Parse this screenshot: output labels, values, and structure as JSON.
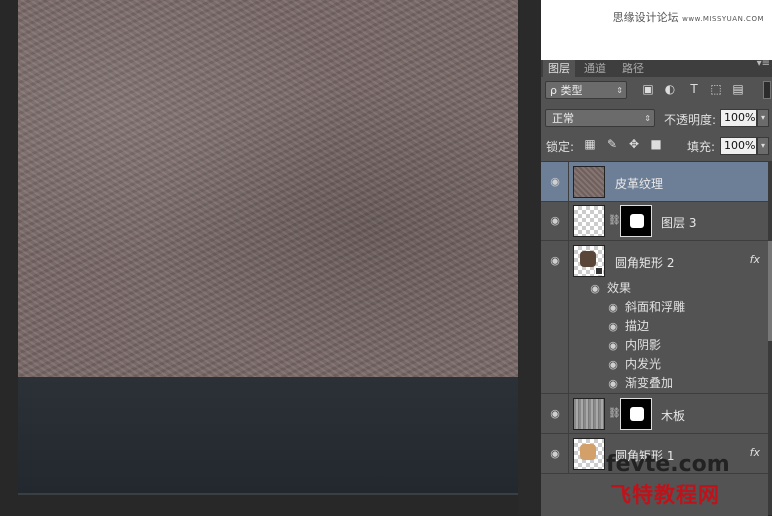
{
  "banner": {
    "site_cn": "思缘设计论坛",
    "site_url": "www.MISSYUAN.COM"
  },
  "tabs": [
    {
      "label": "图层",
      "active": true
    },
    {
      "label": "通道",
      "active": false
    },
    {
      "label": "路径",
      "active": false
    }
  ],
  "panel_menu_icon": "panel-menu-icon",
  "filter": {
    "kind_prefix": "ρ",
    "kind_label": "类型",
    "icons": [
      "image-filter-icon",
      "adjustment-filter-icon",
      "type-filter-icon",
      "shape-filter-icon",
      "smart-object-filter-icon"
    ]
  },
  "blend": {
    "mode": "正常",
    "opacity_label": "不透明度:",
    "opacity": "100%",
    "lock_label": "锁定:",
    "fill_label": "填充:",
    "fill": "100%"
  },
  "lock_icons": [
    "lock-transparent-icon",
    "lock-brush-icon",
    "lock-move-icon",
    "lock-all-icon"
  ],
  "layers": [
    {
      "name": "皮革纹理",
      "selected": true
    },
    {
      "name": "图层 3"
    },
    {
      "name": "圆角矩形 2",
      "fx": "fx"
    },
    {
      "name": "木板"
    },
    {
      "name": "圆角矩形 1",
      "fx": "fx"
    }
  ],
  "effects_group": {
    "label": "效果",
    "items": [
      "斜面和浮雕",
      "描边",
      "内阴影",
      "内发光",
      "渐变叠加"
    ]
  },
  "watermark": {
    "top": "fevte.com",
    "bottom": "飞特教程网"
  },
  "colors": {
    "selected_row": "#6d7f97",
    "panel_bg": "#535353",
    "leather": "#7a6a68",
    "watermark_red": "#c0121a"
  }
}
